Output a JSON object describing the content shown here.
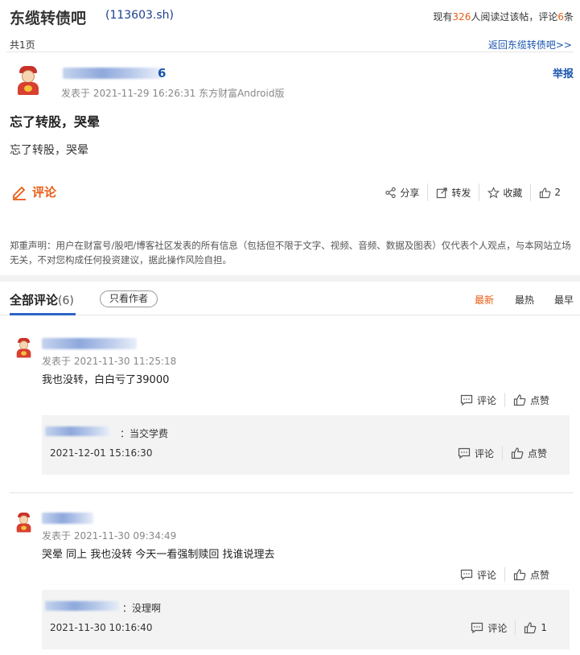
{
  "header": {
    "bar_title": "东缆转债吧",
    "bar_code": "(113603.sh)",
    "readers_prefix": "现有",
    "readers_count": "326",
    "readers_mid": "人阅读过该帖，评论",
    "comments_count": "6",
    "readers_suffix": "条"
  },
  "post": {
    "page_count": "共1页",
    "back_link": "返回东缆转债吧>>",
    "author_suffix": "6",
    "meta": "发表于 2021-11-29 16:26:31 东方财富Android版",
    "report": "举报",
    "title": "忘了转股，哭晕",
    "body": "忘了转股，哭晕",
    "comment_label": "评论",
    "share": "分享",
    "forward": "转发",
    "favorite": "收藏",
    "likes": "2",
    "disclaimer": "郑重声明：用户在财富号/股吧/博客社区发表的所有信息（包括但不限于文字、视频、音频、数据及图表）仅代表个人观点，与本网站立场无关，不对您构成任何投资建议，据此操作风险自担。"
  },
  "comments_section": {
    "tab_label": "全部评论",
    "tab_count": "(6)",
    "only_author": "只看作者",
    "sort_latest": "最新",
    "sort_hot": "最热",
    "sort_earliest": "最早",
    "action_comment": "评论",
    "action_like": "点赞",
    "comments": [
      {
        "meta": "发表于 2021-11-30 11:25:18",
        "text": "我也没转，白白亏了39000",
        "reply": {
          "text": "：当交学费",
          "time": "2021-12-01 15:16:30",
          "like_label": "点赞"
        }
      },
      {
        "meta": "发表于 2021-11-30 09:34:49",
        "text": "哭晕 同上 我也没转 今天一看强制赎回 找谁说理去",
        "reply": {
          "text": "：没理啊",
          "time": "2021-11-30 10:16:40",
          "like_count": "1"
        }
      }
    ]
  },
  "colors": {
    "accent_orange": "#e85d15",
    "link_blue": "#1a55b0",
    "tab_blue": "#2c64c7"
  }
}
